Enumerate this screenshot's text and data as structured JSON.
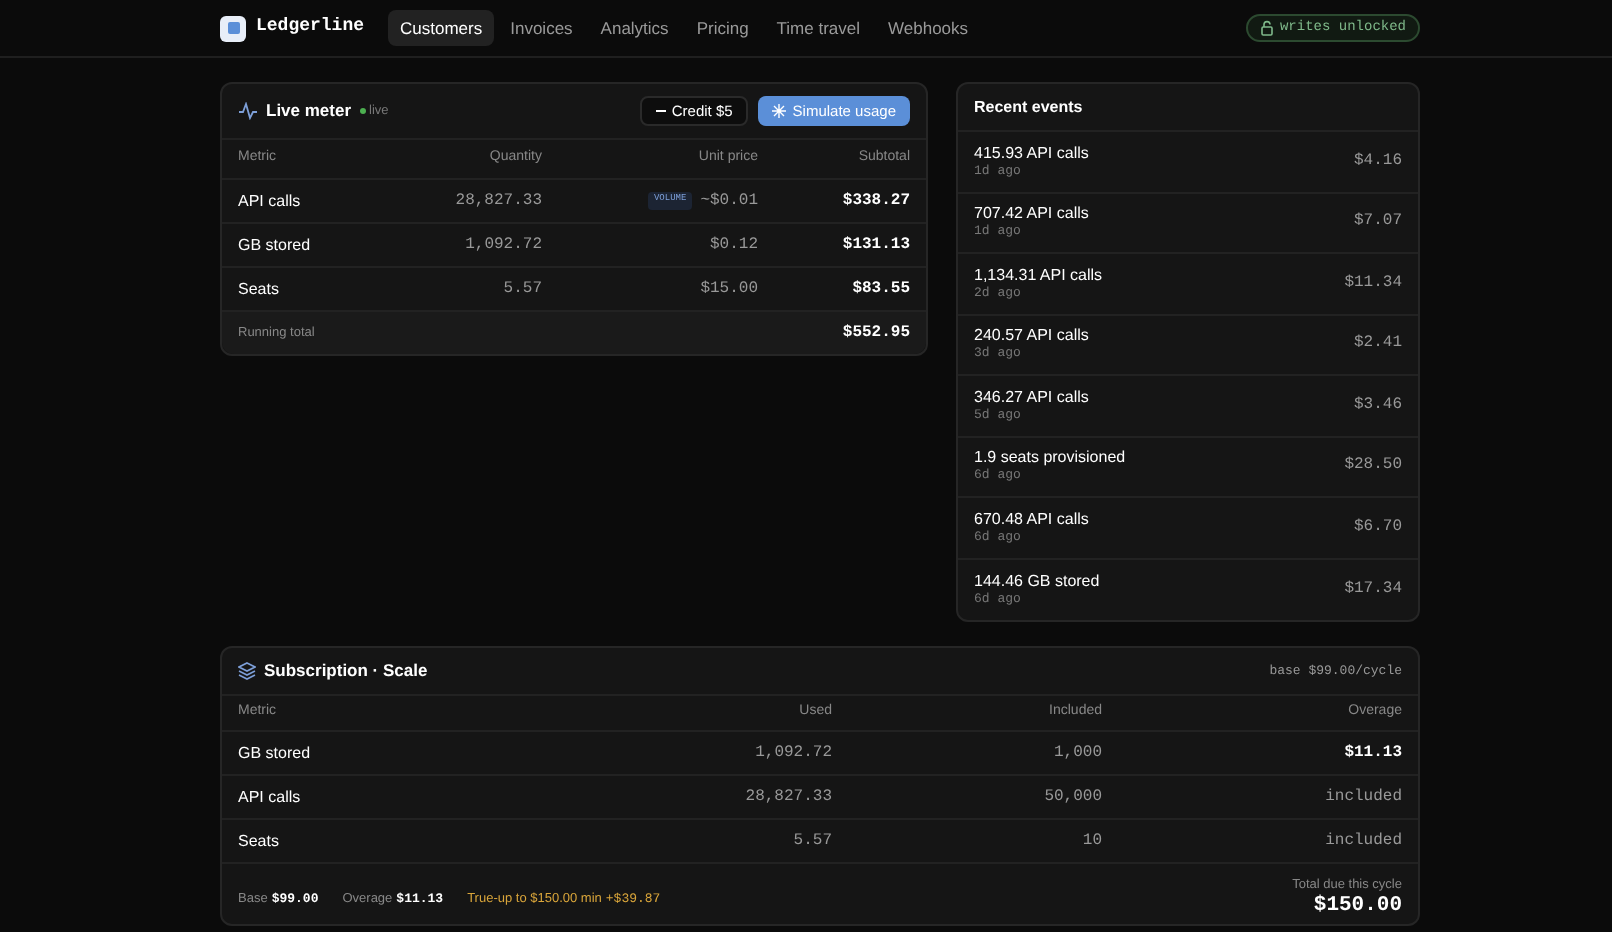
{
  "brand": "Ledgerline",
  "nav": [
    {
      "label": "Customers",
      "selected": true
    },
    {
      "label": "Invoices",
      "selected": false
    },
    {
      "label": "Analytics",
      "selected": false
    },
    {
      "label": "Pricing",
      "selected": false
    },
    {
      "label": "Time travel",
      "selected": false
    },
    {
      "label": "Webhooks",
      "selected": false
    }
  ],
  "status_badge": "writes unlocked",
  "live_meter": {
    "title": "Live meter",
    "live": "live",
    "credit_button": "Credit $5",
    "simulate_button": "Simulate usage",
    "columns": [
      "Metric",
      "Quantity",
      "Unit price",
      "Subtotal"
    ],
    "rows": [
      {
        "metric": "API calls",
        "quantity": "28,827.33",
        "badge": "VOLUME",
        "unit_price": "~$0.01",
        "subtotal": "$338.27"
      },
      {
        "metric": "GB stored",
        "quantity": "1,092.72",
        "unit_price": "$0.12",
        "subtotal": "$131.13"
      },
      {
        "metric": "Seats",
        "quantity": "5.57",
        "unit_price": "$15.00",
        "subtotal": "$83.55"
      }
    ],
    "total_label": "Running total",
    "total": "$552.95"
  },
  "recent_events": {
    "title": "Recent events",
    "events": [
      {
        "text": "415.93 API calls",
        "time": "1d ago",
        "amount": "$4.16"
      },
      {
        "text": "707.42 API calls",
        "time": "1d ago",
        "amount": "$7.07"
      },
      {
        "text": "1,134.31 API calls",
        "time": "2d ago",
        "amount": "$11.34"
      },
      {
        "text": "240.57 API calls",
        "time": "3d ago",
        "amount": "$2.41"
      },
      {
        "text": "346.27 API calls",
        "time": "5d ago",
        "amount": "$3.46"
      },
      {
        "text": "1.9 seats provisioned",
        "time": "6d ago",
        "amount": "$28.50"
      },
      {
        "text": "670.48 API calls",
        "time": "6d ago",
        "amount": "$6.70"
      },
      {
        "text": "144.46 GB stored",
        "time": "6d ago",
        "amount": "$17.34"
      }
    ]
  },
  "subscription": {
    "title": "Subscription · Scale",
    "base_note": "base $99.00/cycle",
    "columns": [
      "Metric",
      "Used",
      "Included",
      "Overage"
    ],
    "rows": [
      {
        "metric": "GB stored",
        "used": "1,092.72",
        "included": "1,000",
        "overage": "$11.13",
        "kind": "charge"
      },
      {
        "metric": "API calls",
        "used": "28,827.33",
        "included": "50,000",
        "overage": "included",
        "kind": "included"
      },
      {
        "metric": "Seats",
        "used": "5.57",
        "included": "10",
        "overage": "included",
        "kind": "included"
      }
    ],
    "base_label": "Base",
    "base_value": "$99.00",
    "overage_label": "Overage",
    "overage_value": "$11.13",
    "trueup_label": "True-up to $150.00 min",
    "trueup_value": "+$39.87",
    "total_label": "Total due this cycle",
    "total": "$150.00"
  }
}
